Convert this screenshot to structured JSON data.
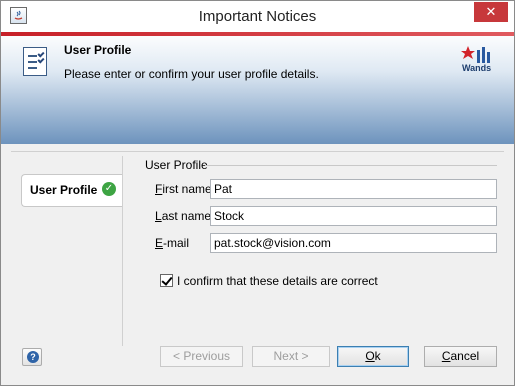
{
  "window": {
    "title": "Important Notices",
    "close_glyph": "✕",
    "app_icon": "java-app-icon"
  },
  "header": {
    "title": "User Profile",
    "subtitle": "Please enter or confirm your user profile details.",
    "icon": "checklist-document-icon",
    "brand": "Wands",
    "accent_color": "#c72028",
    "gradient_bottom": "#6d93bd"
  },
  "sidebar": {
    "items": [
      {
        "label": "User Profile",
        "icon": "check-circle-icon",
        "status_color": "#3da443",
        "check_glyph": "✓"
      }
    ]
  },
  "form": {
    "group_label": "User Profile",
    "fields": [
      {
        "label_key": "F",
        "label_rest": "irst name",
        "value": "Pat"
      },
      {
        "label_key": "L",
        "label_rest": "ast name",
        "value": "Stock"
      },
      {
        "label_key": "E",
        "label_rest": "-mail",
        "value": "pat.stock@vision.com"
      }
    ],
    "confirm": {
      "checked": true,
      "label": "I confirm that these details are correct"
    }
  },
  "footer": {
    "help_glyph": "?",
    "previous": "< Previous",
    "next": "Next >",
    "ok_key": "O",
    "ok_rest": "k",
    "cancel_key": "C",
    "cancel_rest": "ancel"
  }
}
